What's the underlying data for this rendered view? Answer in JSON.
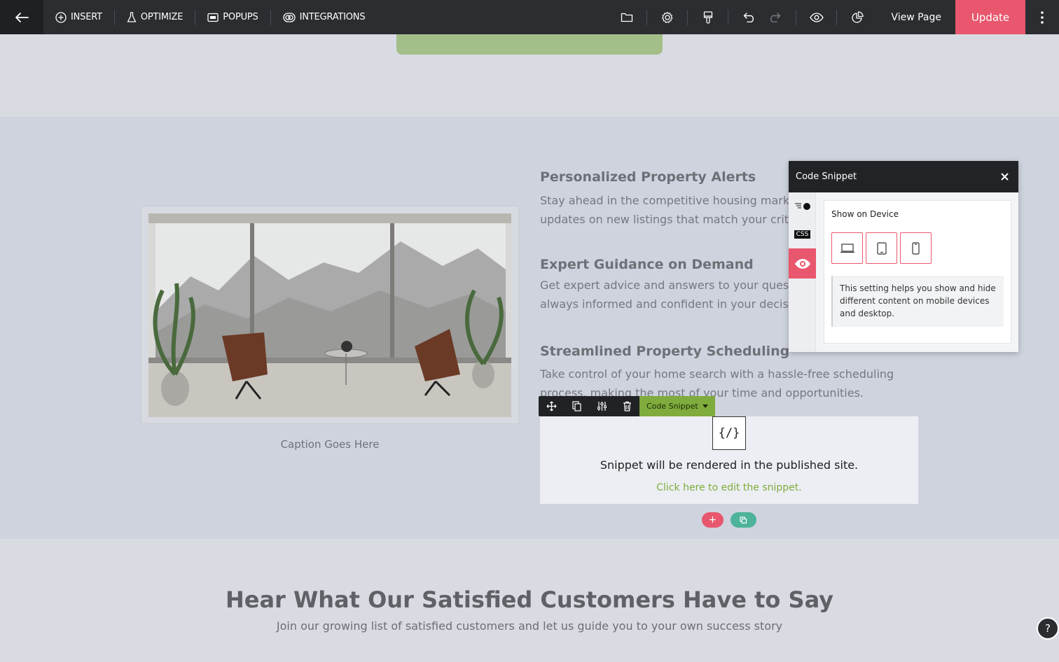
{
  "toolbar": {
    "insert": "INSERT",
    "optimize": "OPTIMIZE",
    "popups": "POPUPS",
    "integrations": "INTEGRATIONS",
    "view_page": "View Page",
    "update": "Update"
  },
  "features": [
    {
      "title": "Personalized Property Alerts",
      "line1": "Stay ahead in the competitive housing market l",
      "line2": "updates on new listings that match your criteria"
    },
    {
      "title": "Expert Guidance on Demand",
      "line1": "Get expert advice and answers to your question",
      "line2": "always informed and confident in your decision"
    },
    {
      "title": "Streamlined Property Scheduling",
      "line1": "Take control of your home search with a hassle-free scheduling",
      "line2": "process, making the most of your time and opportunities."
    }
  ],
  "image_caption": "Caption Goes Here",
  "element_toolbar": {
    "label": "Code Snippet"
  },
  "snippet": {
    "icon_text": "{/}",
    "message": "Snippet will be rendered in the published site.",
    "link": "Click here to edit the snippet."
  },
  "add_button": "+",
  "testimonials": {
    "title": "Hear What Our Satisfied Customers Have to Say",
    "subtitle": "Join our growing list of satisfied customers and let us guide you to your own success story"
  },
  "panel": {
    "title": "Code Snippet",
    "css_tab": "CSS",
    "section_label": "Show on Device",
    "devices": [
      "desktop",
      "tablet",
      "mobile"
    ],
    "help_text": "This setting helps you show and hide different content on mobile devices and desktop."
  },
  "help_button": "?",
  "colors": {
    "accent": "#e8576d",
    "green": "#7fac3c",
    "toolbar": "#2b2d31"
  }
}
